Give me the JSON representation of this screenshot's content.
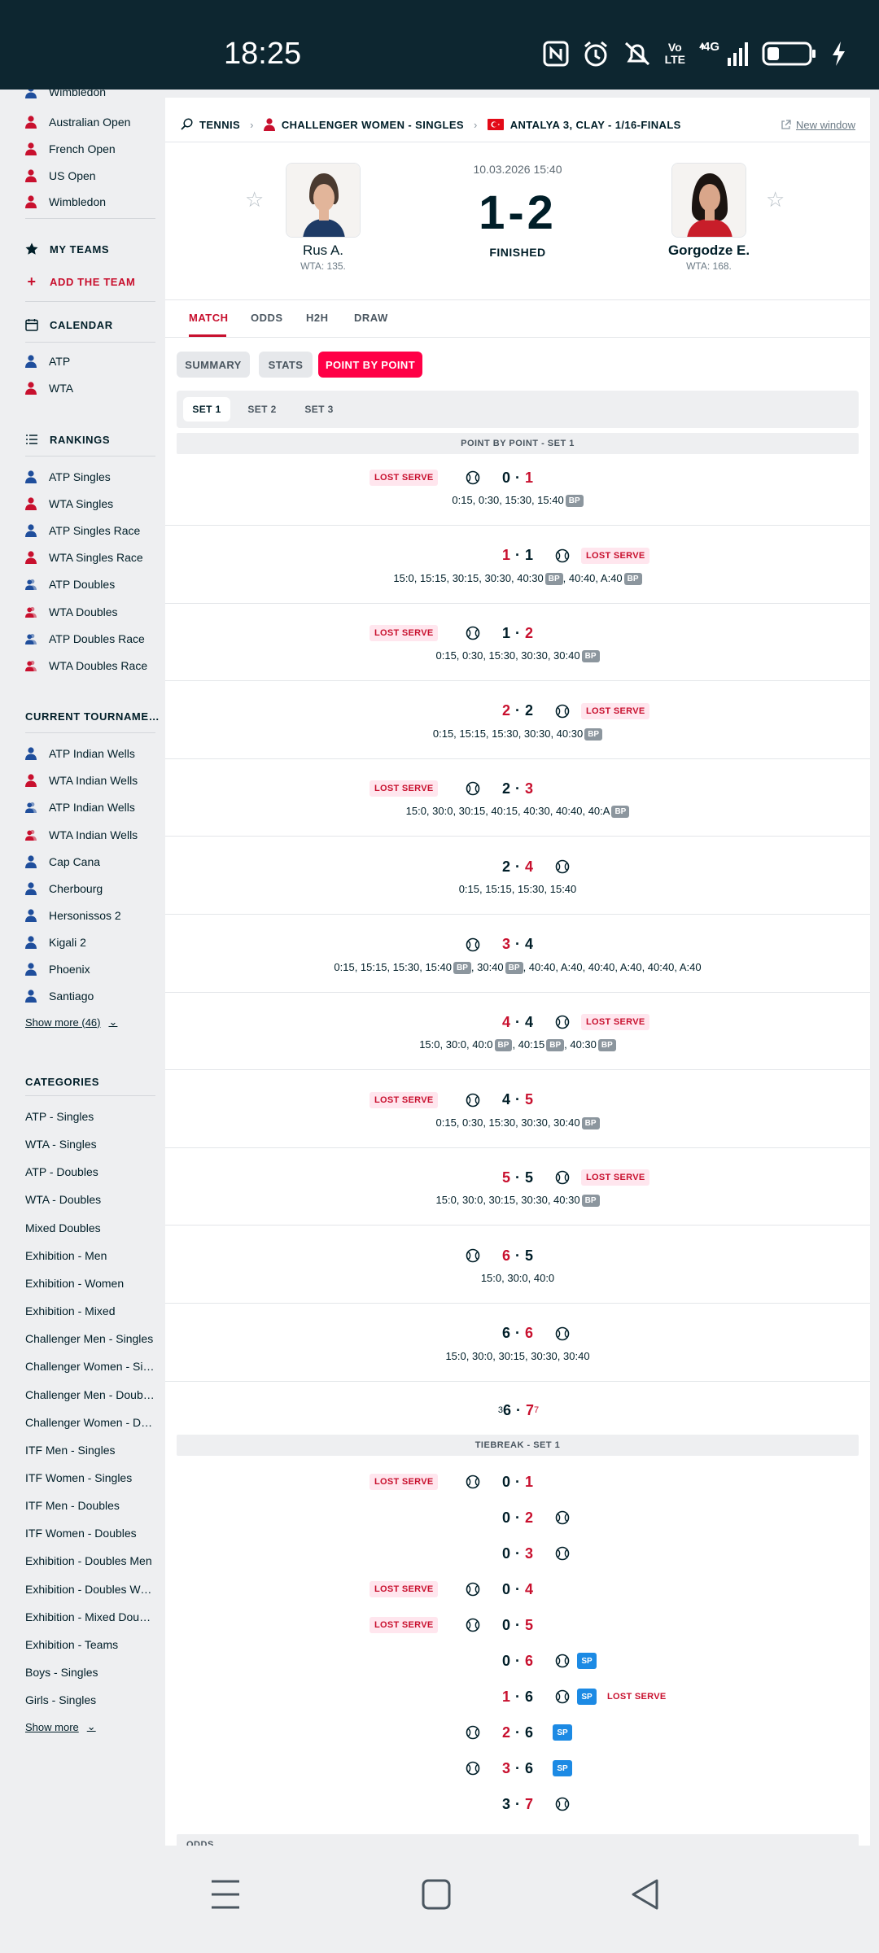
{
  "status_bar": {
    "time": "18:25",
    "icons": [
      "nfc-icon",
      "alarm-icon",
      "mute-icon",
      "volte-icon",
      "4g-signal-icon",
      "battery-icon",
      "charging-icon"
    ],
    "volte_top": "Vo",
    "volte_bottom": "LTE",
    "net_label": "4G"
  },
  "sidebar": {
    "cut_top_item": "Wimbledon",
    "tournaments": [
      {
        "label": "Australian Open",
        "icon": "player-red-icon"
      },
      {
        "label": "French Open",
        "icon": "player-red-icon"
      },
      {
        "label": "US Open",
        "icon": "player-red-icon"
      },
      {
        "label": "Wimbledon",
        "icon": "player-red-icon"
      }
    ],
    "my_teams_title": "MY TEAMS",
    "add_team_label": "ADD THE TEAM",
    "calendar_title": "CALENDAR",
    "calendar_items": [
      {
        "label": "ATP",
        "icon": "player-blue-icon"
      },
      {
        "label": "WTA",
        "icon": "player-red-icon"
      }
    ],
    "rankings_title": "RANKINGS",
    "rankings_items": [
      {
        "label": "ATP Singles",
        "icon": "player-blue-icon"
      },
      {
        "label": "WTA Singles",
        "icon": "player-red-icon"
      },
      {
        "label": "ATP Singles Race",
        "icon": "player-blue-icon"
      },
      {
        "label": "WTA Singles Race",
        "icon": "player-red-icon"
      },
      {
        "label": "ATP Doubles",
        "icon": "doubles-blue-icon"
      },
      {
        "label": "WTA Doubles",
        "icon": "doubles-red-icon"
      },
      {
        "label": "ATP Doubles Race",
        "icon": "doubles-blue-icon"
      },
      {
        "label": "WTA Doubles Race",
        "icon": "doubles-red-icon"
      }
    ],
    "current_title": "CURRENT TOURNAMENTS",
    "current_items": [
      {
        "label": "ATP Indian Wells",
        "icon": "player-blue-icon"
      },
      {
        "label": "WTA Indian Wells",
        "icon": "player-red-icon"
      },
      {
        "label": "ATP Indian Wells",
        "icon": "doubles-blue-icon"
      },
      {
        "label": "WTA Indian Wells",
        "icon": "doubles-red-icon"
      },
      {
        "label": "Cap Cana",
        "icon": "player-blue-icon"
      },
      {
        "label": "Cherbourg",
        "icon": "player-blue-icon"
      },
      {
        "label": "Hersonissos 2",
        "icon": "player-blue-icon"
      },
      {
        "label": "Kigali 2",
        "icon": "player-blue-icon"
      },
      {
        "label": "Phoenix",
        "icon": "player-blue-icon"
      },
      {
        "label": "Santiago",
        "icon": "player-blue-icon"
      }
    ],
    "current_show_more": "Show more (46)",
    "categories_title": "CATEGORIES",
    "categories": [
      "ATP - Singles",
      "WTA - Singles",
      "ATP - Doubles",
      "WTA - Doubles",
      "Mixed Doubles",
      "Exhibition - Men",
      "Exhibition - Women",
      "Exhibition - Mixed",
      "Challenger Men - Singles",
      "Challenger Women - Singles",
      "Challenger Men - Doubles",
      "Challenger Women - Doubles",
      "ITF Men - Singles",
      "ITF Women - Singles",
      "ITF Men - Doubles",
      "ITF Women - Doubles",
      "Exhibition - Doubles Men",
      "Exhibition - Doubles Women",
      "Exhibition - Mixed Doubles",
      "Exhibition - Teams",
      "Boys - Singles",
      "Girls - Singles"
    ],
    "categories_show_more": "Show more"
  },
  "breadcrumb": {
    "sport": "TENNIS",
    "category": "CHALLENGER WOMEN - SINGLES",
    "tournament": "ANTALYA 3, CLAY - 1/16-FINALS",
    "new_window": "New window"
  },
  "match": {
    "home": {
      "name": "Rus A.",
      "rank": "WTA: 135."
    },
    "away": {
      "name": "Gorgodze E.",
      "rank": "WTA: 168."
    },
    "date": "10.03.2026 15:40",
    "score": "1-2",
    "status": "FINISHED"
  },
  "tabs": [
    "MATCH",
    "ODDS",
    "H2H",
    "DRAW"
  ],
  "subtabs": [
    "SUMMARY",
    "STATS",
    "POINT BY POINT"
  ],
  "set_tabs": [
    "SET 1",
    "SET 2",
    "SET 3"
  ],
  "section_title": "POINT BY POINT - SET 1",
  "lost_serve_label": "LOST SERVE",
  "bp_label": "BP",
  "sp_label": "SP",
  "games": [
    {
      "home": "0",
      "away": "1",
      "server": "home",
      "lost": "home",
      "lead": "away",
      "points": [
        {
          "t": "0:15, 0:30, 15:30, 15:40",
          "bp": true
        }
      ]
    },
    {
      "home": "1",
      "away": "1",
      "server": "away",
      "lost": "away",
      "lead": "home",
      "points": [
        {
          "t": "15:0, 15:15, 30:15, 30:30, 40:30",
          "bp": true
        },
        {
          "t": ", 40:40, A:40",
          "bp": true
        }
      ]
    },
    {
      "home": "1",
      "away": "2",
      "server": "home",
      "lost": "home",
      "lead": "away",
      "points": [
        {
          "t": "0:15, 0:30, 15:30, 30:30, 30:40",
          "bp": true
        }
      ]
    },
    {
      "home": "2",
      "away": "2",
      "server": "away",
      "lost": "away",
      "lead": "home",
      "points": [
        {
          "t": "0:15, 15:15, 15:30, 30:30, 40:30",
          "bp": true
        }
      ]
    },
    {
      "home": "2",
      "away": "3",
      "server": "home",
      "lost": "home",
      "lead": "away",
      "points": [
        {
          "t": "15:0, 30:0, 30:15, 40:15, 40:30, 40:40, 40:A",
          "bp": true
        }
      ]
    },
    {
      "home": "2",
      "away": "4",
      "server": "away",
      "lost": "",
      "lead": "away",
      "points": [
        {
          "t": "0:15, 15:15, 15:30, 15:40",
          "bp": false
        }
      ]
    },
    {
      "home": "3",
      "away": "4",
      "server": "home",
      "lost": "",
      "lead": "home",
      "points": [
        {
          "t": "0:15, 15:15, 15:30, 15:40",
          "bp": true
        },
        {
          "t": ", 30:40",
          "bp": true
        },
        {
          "t": ", 40:40, A:40, 40:40, A:40, 40:40, A:40",
          "bp": false
        }
      ]
    },
    {
      "home": "4",
      "away": "4",
      "server": "away",
      "lost": "away",
      "lead": "home",
      "points": [
        {
          "t": "15:0, 30:0, 40:0",
          "bp": true
        },
        {
          "t": ", 40:15",
          "bp": true
        },
        {
          "t": ", 40:30",
          "bp": true
        }
      ]
    },
    {
      "home": "4",
      "away": "5",
      "server": "home",
      "lost": "home",
      "lead": "away",
      "points": [
        {
          "t": "0:15, 0:30, 15:30, 30:30, 30:40",
          "bp": true
        }
      ]
    },
    {
      "home": "5",
      "away": "5",
      "server": "away",
      "lost": "away",
      "lead": "home",
      "points": [
        {
          "t": "15:0, 30:0, 30:15, 30:30, 40:30",
          "bp": true
        }
      ]
    },
    {
      "home": "6",
      "away": "5",
      "server": "home",
      "lost": "",
      "lead": "home",
      "points": [
        {
          "t": "15:0, 30:0, 40:0",
          "bp": false
        }
      ]
    },
    {
      "home": "6",
      "away": "6",
      "server": "away",
      "lost": "",
      "lead": "away",
      "points": [
        {
          "t": "15:0, 30:0, 30:15, 30:30, 30:40",
          "bp": false
        }
      ]
    }
  ],
  "set_final": {
    "home_sup": "3",
    "home": "6",
    "away": "7",
    "away_sup": "7"
  },
  "tiebreak_title": "TIEBREAK - SET 1",
  "tiebreak": [
    {
      "home": "0",
      "away": "1",
      "server": "home",
      "lost": "home",
      "lead": "away",
      "sp": false
    },
    {
      "home": "0",
      "away": "2",
      "server": "away",
      "lost": "",
      "lead": "away",
      "sp": false
    },
    {
      "home": "0",
      "away": "3",
      "server": "away",
      "lost": "",
      "lead": "away",
      "sp": false
    },
    {
      "home": "0",
      "away": "4",
      "server": "home",
      "lost": "home",
      "lead": "away",
      "sp": false
    },
    {
      "home": "0",
      "away": "5",
      "server": "home",
      "lost": "home",
      "lead": "away",
      "sp": false
    },
    {
      "home": "0",
      "away": "6",
      "server": "away",
      "lost": "",
      "lead": "away",
      "sp": true
    },
    {
      "home": "1",
      "away": "6",
      "server": "away",
      "lost": "away",
      "lead": "home",
      "sp": true
    },
    {
      "home": "2",
      "away": "6",
      "server": "home",
      "lost": "",
      "lead": "home",
      "sp": true
    },
    {
      "home": "3",
      "away": "6",
      "server": "home",
      "lost": "",
      "lead": "home",
      "sp": true
    },
    {
      "home": "3",
      "away": "7",
      "server": "away",
      "lost": "",
      "lead": "away",
      "sp": false
    }
  ],
  "odds_title": "ODDS",
  "nav_bar": {
    "icons": [
      "menu-icon",
      "home-square-icon",
      "back-triangle-icon"
    ]
  },
  "colors": {
    "accent": "#c8102e",
    "pill_active": "#ff0046",
    "status_bar": "#0d2630",
    "sp_blue": "#1c8ae4"
  }
}
